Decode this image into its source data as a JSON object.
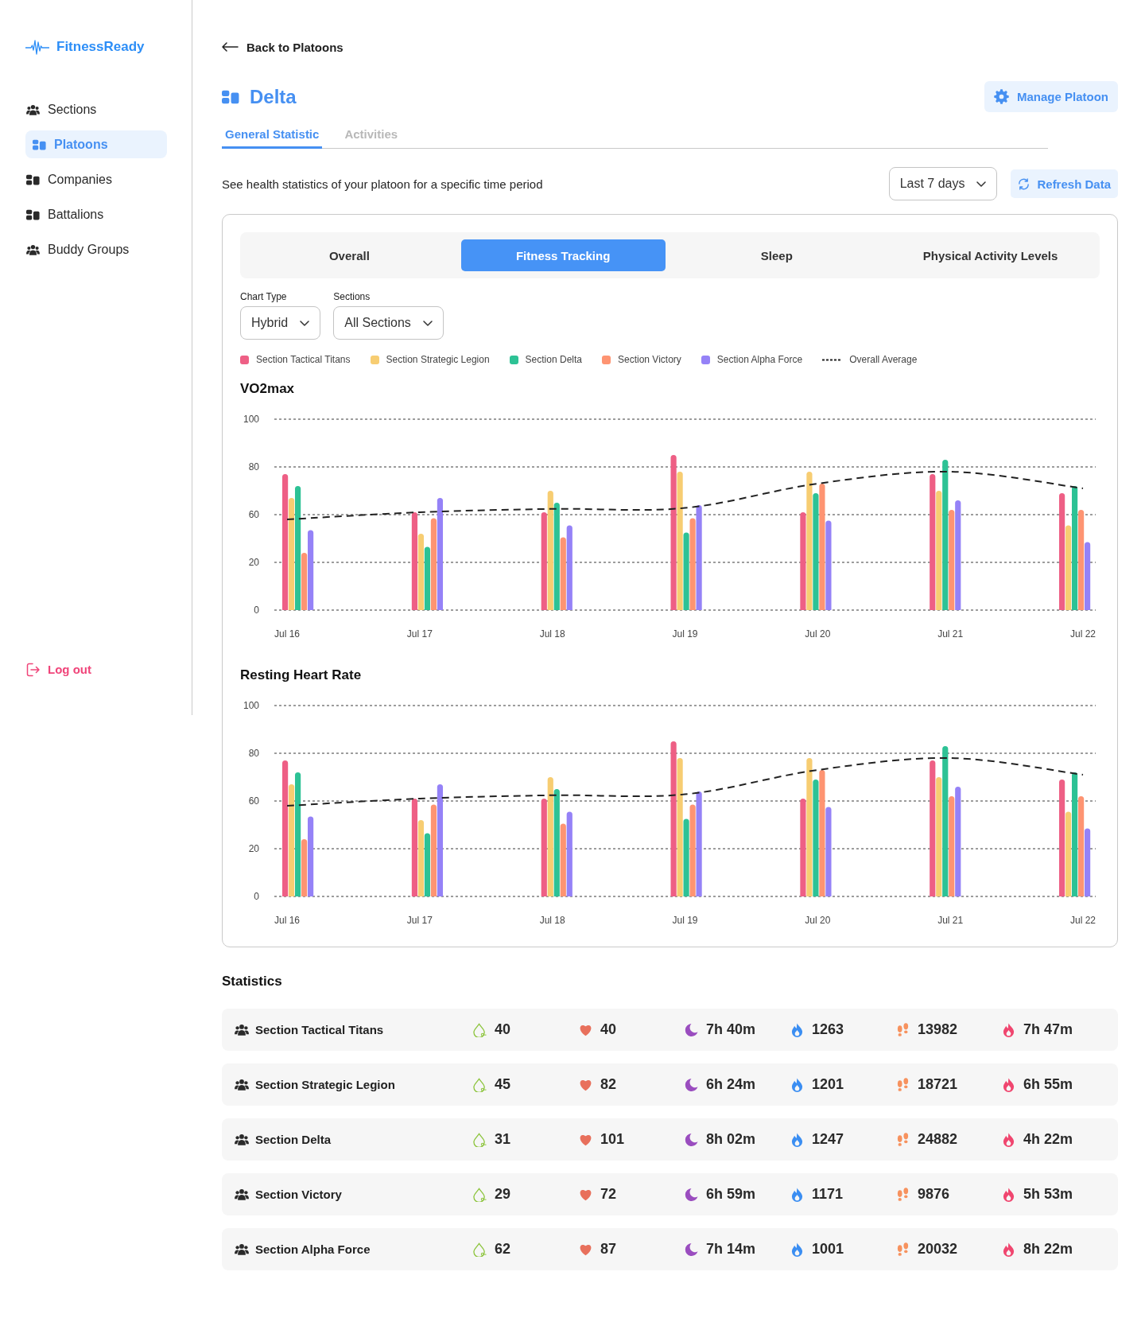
{
  "sidebar": {
    "logo": "FitnessReady",
    "items": [
      {
        "label": "Sections",
        "kind": "group",
        "selected": false
      },
      {
        "label": "Platoons",
        "kind": "unit",
        "selected": true
      },
      {
        "label": "Companies",
        "kind": "unit",
        "selected": false
      },
      {
        "label": "Battalions",
        "kind": "unit",
        "selected": false
      },
      {
        "label": "Buddy Groups",
        "kind": "group",
        "selected": false
      }
    ],
    "logout": "Log out"
  },
  "header": {
    "back_link": "Back to Platoons",
    "title": "Delta",
    "manage_button": "Manage Platoon"
  },
  "tabs": [
    {
      "label": "General Statistic",
      "selected": true
    },
    {
      "label": "Activities",
      "selected": false
    }
  ],
  "toolbar": {
    "description": "See health statistics of your platoon for a specific time period",
    "period_select": "Last 7 days",
    "refresh_button": "Refresh Data"
  },
  "panel": {
    "segments": [
      {
        "label": "Overall",
        "selected": false
      },
      {
        "label": "Fitness Tracking",
        "selected": true
      },
      {
        "label": "Sleep",
        "selected": false
      },
      {
        "label": "Physical Activity Levels",
        "selected": false
      }
    ],
    "filters": [
      {
        "label": "Chart Type",
        "value": "Hybrid"
      },
      {
        "label": "Sections",
        "value": "All Sections"
      }
    ],
    "legend": [
      {
        "label": "Section Tactical Titans",
        "kind": "swatch",
        "color": "#ee5f85"
      },
      {
        "label": "Section Strategic Legion",
        "kind": "swatch",
        "color": "#f7cd72"
      },
      {
        "label": "Section Delta",
        "kind": "swatch",
        "color": "#2dc295"
      },
      {
        "label": "Section Victory",
        "kind": "swatch",
        "color": "#fe9472"
      },
      {
        "label": "Section Alpha Force",
        "kind": "swatch",
        "color": "#9582f7"
      },
      {
        "label": "Overall Average",
        "kind": "dashed"
      }
    ],
    "charts": [
      {
        "title": "VO2max",
        "y_axis_labels": [
          "100",
          "80",
          "60",
          "20",
          "0"
        ],
        "x_axis_labels": [
          "Jul 16",
          "Jul 17",
          "Jul 18",
          "Jul 19",
          "Jul 20",
          "Jul 21",
          "Jul 22"
        ]
      },
      {
        "title": "Resting Heart Rate",
        "y_axis_labels": [
          "100",
          "80",
          "60",
          "20",
          "0"
        ],
        "x_axis_labels": [
          "Jul 16",
          "Jul 17",
          "Jul 18",
          "Jul 19",
          "Jul 20",
          "Jul 21",
          "Jul 22"
        ]
      }
    ]
  },
  "statistics": {
    "title": "Statistics",
    "rows": [
      {
        "name": "Section Tactical Titans",
        "metrics": [
          {
            "kind": "vo2",
            "value": "40"
          },
          {
            "kind": "heart",
            "value": "40"
          },
          {
            "kind": "sleep",
            "value": "7h 40m"
          },
          {
            "kind": "calories",
            "value": "1263"
          },
          {
            "kind": "steps",
            "value": "13982"
          },
          {
            "kind": "active",
            "value": "7h 47m"
          }
        ]
      },
      {
        "name": "Section Strategic Legion",
        "metrics": [
          {
            "kind": "vo2",
            "value": "45"
          },
          {
            "kind": "heart",
            "value": "82"
          },
          {
            "kind": "sleep",
            "value": "6h 24m"
          },
          {
            "kind": "calories",
            "value": "1201"
          },
          {
            "kind": "steps",
            "value": "18721"
          },
          {
            "kind": "active",
            "value": "6h 55m"
          }
        ]
      },
      {
        "name": "Section Delta",
        "metrics": [
          {
            "kind": "vo2",
            "value": "31"
          },
          {
            "kind": "heart",
            "value": "101"
          },
          {
            "kind": "sleep",
            "value": "8h 02m"
          },
          {
            "kind": "calories",
            "value": "1247"
          },
          {
            "kind": "steps",
            "value": "24882"
          },
          {
            "kind": "active",
            "value": "4h 22m"
          }
        ]
      },
      {
        "name": "Section Victory",
        "metrics": [
          {
            "kind": "vo2",
            "value": "29"
          },
          {
            "kind": "heart",
            "value": "72"
          },
          {
            "kind": "sleep",
            "value": "6h 59m"
          },
          {
            "kind": "calories",
            "value": "1171"
          },
          {
            "kind": "steps",
            "value": "9876"
          },
          {
            "kind": "active",
            "value": "5h 53m"
          }
        ]
      },
      {
        "name": "Section Alpha Force",
        "metrics": [
          {
            "kind": "vo2",
            "value": "62"
          },
          {
            "kind": "heart",
            "value": "87"
          },
          {
            "kind": "sleep",
            "value": "7h 14m"
          },
          {
            "kind": "calories",
            "value": "1001"
          },
          {
            "kind": "steps",
            "value": "20032"
          },
          {
            "kind": "active",
            "value": "8h 22m"
          }
        ]
      }
    ]
  }
}
